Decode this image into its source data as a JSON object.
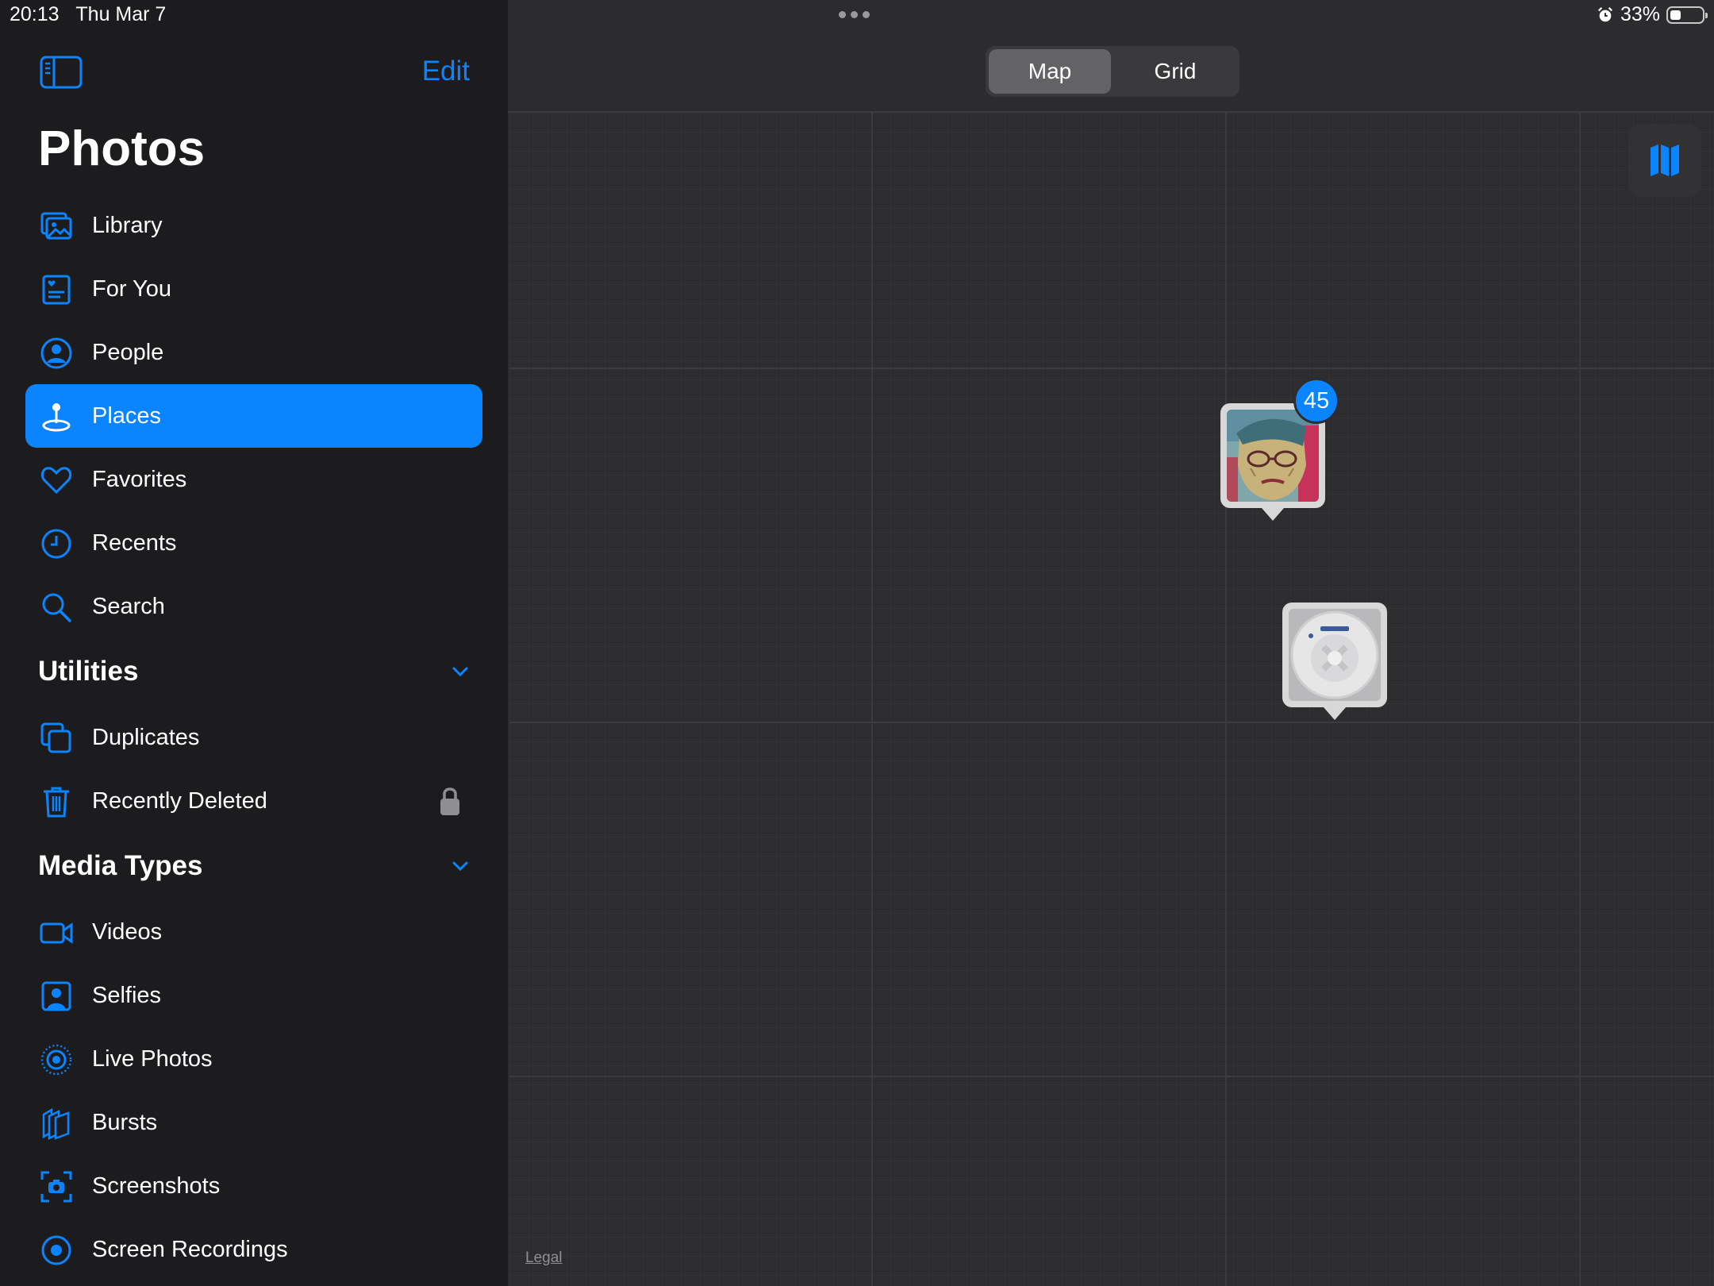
{
  "status_bar": {
    "time": "20:13",
    "date": "Thu Mar 7",
    "battery_text": "33%",
    "battery_level": 0.33
  },
  "sidebar": {
    "edit_label": "Edit",
    "title": "Photos",
    "items": [
      {
        "label": "Library",
        "icon": "photo-library-icon"
      },
      {
        "label": "For You",
        "icon": "for-you-icon"
      },
      {
        "label": "People",
        "icon": "person-circle-icon"
      },
      {
        "label": "Places",
        "icon": "map-pin-icon",
        "selected": true
      },
      {
        "label": "Favorites",
        "icon": "heart-icon"
      },
      {
        "label": "Recents",
        "icon": "clock-icon"
      },
      {
        "label": "Search",
        "icon": "search-icon"
      }
    ],
    "utilities": {
      "title": "Utilities",
      "items": [
        {
          "label": "Duplicates",
          "icon": "duplicates-icon"
        },
        {
          "label": "Recently Deleted",
          "icon": "trash-icon",
          "locked": true
        }
      ]
    },
    "media_types": {
      "title": "Media Types",
      "items": [
        {
          "label": "Videos",
          "icon": "video-icon"
        },
        {
          "label": "Selfies",
          "icon": "selfie-icon"
        },
        {
          "label": "Live Photos",
          "icon": "live-photo-icon"
        },
        {
          "label": "Bursts",
          "icon": "bursts-icon"
        },
        {
          "label": "Screenshots",
          "icon": "screenshot-icon"
        },
        {
          "label": "Screen Recordings",
          "icon": "screen-recording-icon"
        }
      ]
    }
  },
  "main": {
    "segments": [
      {
        "label": "Map",
        "selected": true
      },
      {
        "label": "Grid",
        "selected": false
      }
    ],
    "map": {
      "pins": [
        {
          "count": "45",
          "thumbnail": "portrait-painting"
        },
        {
          "thumbnail": "round-white-device"
        }
      ],
      "legal_label": "Legal"
    }
  },
  "colors": {
    "accent": "#0a84ff",
    "sidebar_bg": "#1c1c1e",
    "map_bg": "#2d2d30"
  }
}
